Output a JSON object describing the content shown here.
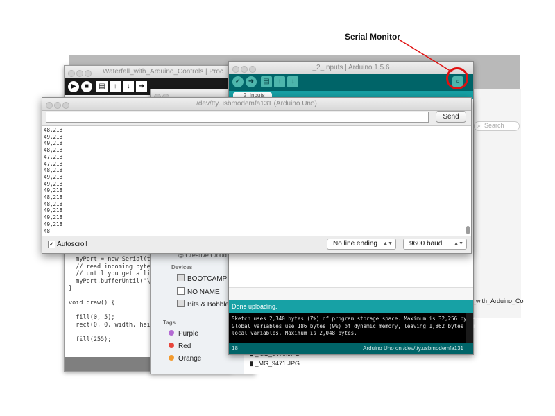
{
  "annotation": {
    "label": "Serial Monitor",
    "color": "#e01010"
  },
  "processing": {
    "title": "Waterfall_with_Arduino_Controls | Proc",
    "code_top": "  myPort = new Serial(th\n  // read incoming byte\n  // until you get a lin\n  myPort.bufferUntil('\\n\n}\n\nvoid draw() {\n\n  fill(0, 5);\n  rect(0, 0, width, heig\n\n  fill(255);"
  },
  "finder": {
    "section_devices": "Devices",
    "devices": [
      "BOOTCAMP",
      "NO NAME",
      "Bits & Bobble"
    ],
    "cloud_label": "Creative Cloud",
    "tags_header": "Tags",
    "tags": [
      {
        "label": "Purple",
        "color": "#b36ad3"
      },
      {
        "label": "Red",
        "color": "#e8463c"
      },
      {
        "label": "Orange",
        "color": "#f29a2e"
      }
    ],
    "files": [
      "_MG_9470.JPG",
      "_MG_9471.JPG"
    ],
    "search_placeholder": "Search",
    "side_path": "_with_Arduino_Co"
  },
  "ide": {
    "title": "_2_Inputs | Arduino 1.5.6",
    "tab": "_2_Inputs",
    "status": "Done uploading.",
    "console": "Sketch uses 2,340 bytes (7%) of program storage space. Maximum is 32,256 bytes.\nGlobal variables use 186 bytes (9%) of dynamic memory, leaving 1,862 bytes for\nlocal variables. Maximum is 2,048 bytes.",
    "line_number": "18",
    "board": "Arduino Uno on /dev/tty.usbmodemfa131",
    "colors": {
      "toolbar": "#006468",
      "status": "#17a1a5"
    }
  },
  "serial": {
    "title": "/dev/tty.usbmodemfa131 (Arduino Uno)",
    "send_label": "Send",
    "lines": [
      "48,218",
      "49,218",
      "49,218",
      "48,218",
      "47,218",
      "47,218",
      "48,218",
      "49,218",
      "49,218",
      "49,218",
      "48,218",
      "48,218",
      "49,218",
      "49,218",
      "49,218",
      "48"
    ],
    "autoscroll_label": "Autoscroll",
    "autoscroll_checked": true,
    "line_ending": "No line ending",
    "baud": "9600 baud"
  }
}
